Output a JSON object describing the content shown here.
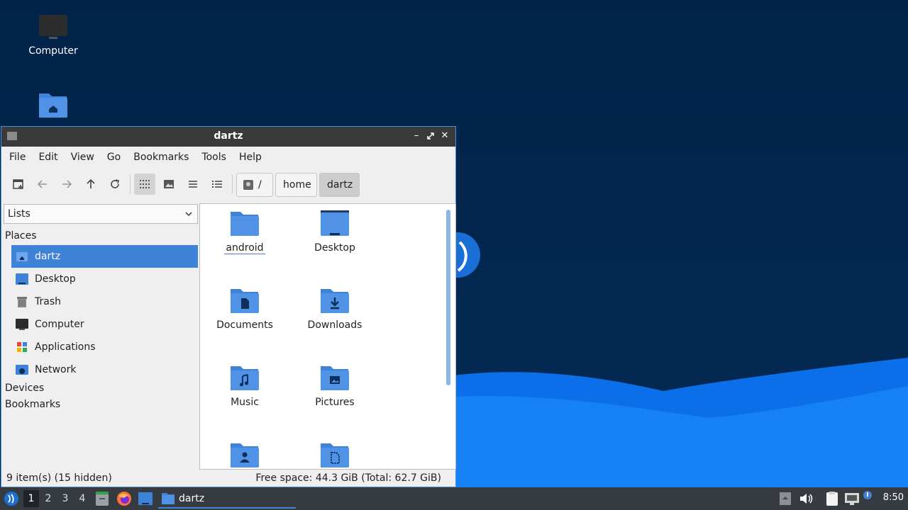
{
  "desktop": {
    "icons": [
      {
        "label": "Computer",
        "icon": "monitor-icon"
      },
      {
        "label": "",
        "icon": "home-folder-icon"
      }
    ]
  },
  "window": {
    "title": "dartz",
    "menus": [
      "File",
      "Edit",
      "View",
      "Go",
      "Bookmarks",
      "Tools",
      "Help"
    ],
    "breadcrumb": [
      "/",
      "home",
      "dartz"
    ],
    "sidebar": {
      "select_value": "Lists",
      "places_header": "Places",
      "places": [
        {
          "label": "dartz",
          "icon": "home-icon",
          "selected": true
        },
        {
          "label": "Desktop",
          "icon": "desktop-icon"
        },
        {
          "label": "Trash",
          "icon": "trash-icon"
        },
        {
          "label": "Computer",
          "icon": "computer-icon"
        },
        {
          "label": "Applications",
          "icon": "applications-icon"
        },
        {
          "label": "Network",
          "icon": "network-icon"
        }
      ],
      "devices_header": "Devices",
      "bookmarks_header": "Bookmarks"
    },
    "files": [
      {
        "label": "android",
        "icon": "folder-icon"
      },
      {
        "label": "Desktop",
        "icon": "desktop-folder-icon"
      },
      {
        "label": "Documents",
        "icon": "documents-folder-icon"
      },
      {
        "label": "Downloads",
        "icon": "downloads-folder-icon"
      },
      {
        "label": "Music",
        "icon": "music-folder-icon"
      },
      {
        "label": "Pictures",
        "icon": "pictures-folder-icon"
      },
      {
        "label": "",
        "icon": "public-folder-icon"
      },
      {
        "label": "",
        "icon": "templates-folder-icon"
      }
    ],
    "status": {
      "items": "9 item(s) (15 hidden)",
      "free_space": "Free space: 44.3 GiB (Total: 62.7 GiB)"
    }
  },
  "taskbar": {
    "workspaces": [
      "1",
      "2",
      "3",
      "4"
    ],
    "active_workspace": "1",
    "task_label": "dartz",
    "clock": "8:50"
  },
  "colors": {
    "accent": "#3f83d8",
    "desktop_bg": "#022349",
    "taskbar_bg": "#363b42",
    "titlebar_bg": "#3a3a3a"
  }
}
